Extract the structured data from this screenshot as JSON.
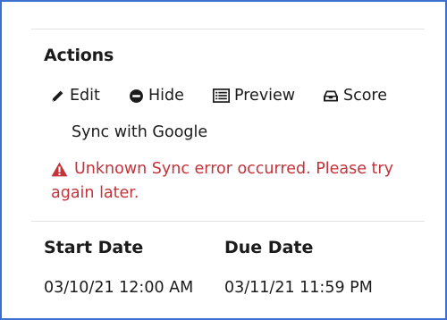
{
  "actions": {
    "title": "Actions",
    "items": [
      {
        "label": "Edit",
        "icon": "pencil-icon"
      },
      {
        "label": "Hide",
        "icon": "minus-circle-icon"
      },
      {
        "label": "Preview",
        "icon": "preview-list-icon"
      },
      {
        "label": "Score",
        "icon": "inbox-tray-icon"
      }
    ],
    "sync_label": "Sync with Google"
  },
  "error": {
    "icon": "warning-triangle-icon",
    "line1": "Unknown Sync error occurred. Please try",
    "line2": "again later.",
    "color": "#c4323a"
  },
  "dates": {
    "start_label": "Start Date",
    "due_label": "Due Date",
    "start_value": "03/10/21 12:00 AM",
    "due_value": "03/11/21 11:59 PM"
  },
  "colors": {
    "frame_border": "#3b6fd0",
    "divider": "#e2e2e2"
  }
}
